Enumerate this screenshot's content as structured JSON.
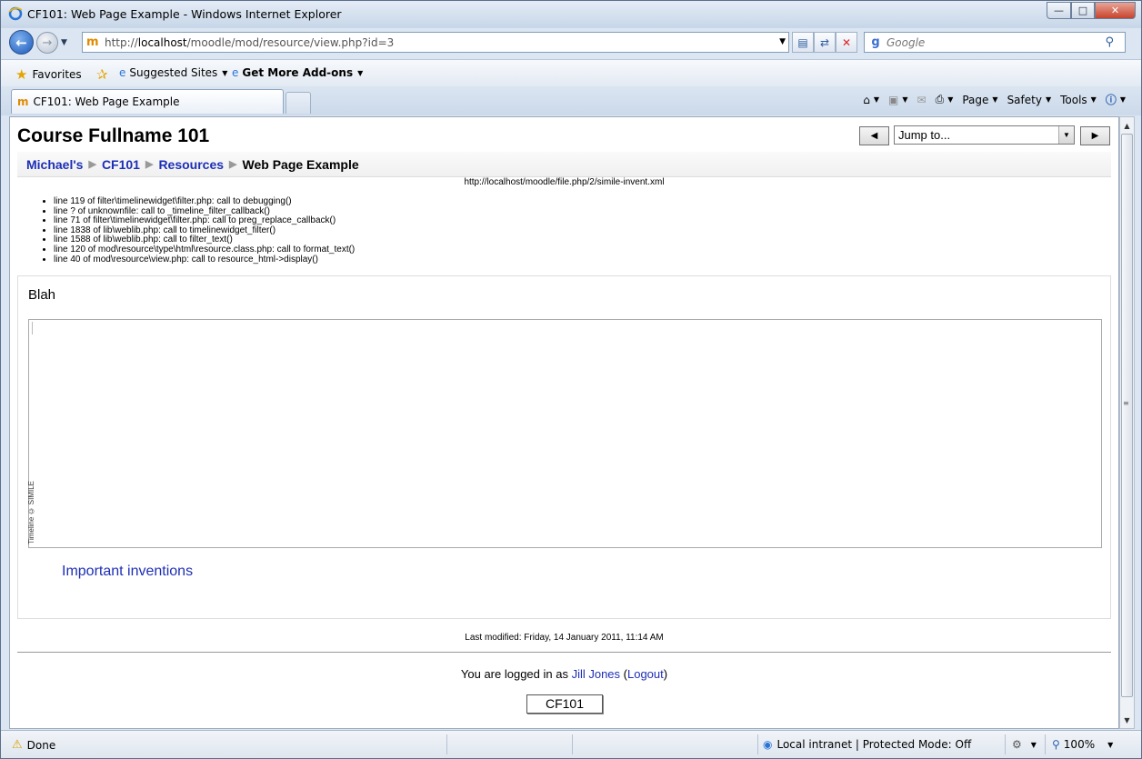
{
  "window": {
    "title": "CF101: Web Page Example - Windows Internet Explorer"
  },
  "address": {
    "scheme_prefix": "http://",
    "host": "localhost",
    "path": "/moodle/mod/resource/view.php?id=3"
  },
  "search": {
    "placeholder": "Google"
  },
  "favorites_bar": {
    "favorites_label": "Favorites",
    "suggested_label": "Suggested Sites",
    "addons_label": "Get More Add-ons"
  },
  "tab": {
    "label": "CF101: Web Page Example"
  },
  "commands": {
    "page": "Page",
    "safety": "Safety",
    "tools": "Tools"
  },
  "page": {
    "course_title": "Course Fullname 101",
    "jump_placeholder": "Jump to...",
    "breadcrumb": [
      "Michael's",
      "CF101",
      "Resources",
      "Web Page Example"
    ],
    "file_url": "http://localhost/moodle/file.php/2/simile-invent.xml",
    "trace": [
      "line 119 of filter\\timelinewidget\\filter.php: call to debugging()",
      "line ? of unknownfile: call to _timeline_filter_callback()",
      "line 71 of filter\\timelinewidget\\filter.php: call to preg_replace_callback()",
      "line 1838 of lib\\weblib.php: call to timelinewidget_filter()",
      "line 1588 of lib\\weblib.php: call to filter_text()",
      "line 120 of mod\\resource\\type\\html\\resource.class.php: call to format_text()",
      "line 40 of mod\\resource\\view.php: call to resource_html->display()"
    ],
    "resource_heading": "Blah",
    "timeline_credit": "Timeline © SIMILE",
    "inventions_link": "Important inventions",
    "last_modified": "Last modified: Friday, 14 January 2011, 11:14 AM",
    "login_prefix": "You are logged in as ",
    "user_name": "Jill Jones",
    "logout_label": "Logout",
    "home_button": "CF101"
  },
  "status": {
    "text": "Done",
    "zone": "Local intranet | Protected Mode: Off",
    "zoom": "100%"
  },
  "icons": [
    "ie-icon",
    "back-arrow-icon",
    "forward-arrow-icon",
    "moodle-favicon",
    "compat-view-icon",
    "refresh-icon",
    "stop-icon",
    "google-icon",
    "search-icon",
    "star-icon",
    "home-icon",
    "feeds-icon",
    "mail-icon",
    "print-icon",
    "help-icon",
    "warning-icon",
    "globe-icon"
  ]
}
